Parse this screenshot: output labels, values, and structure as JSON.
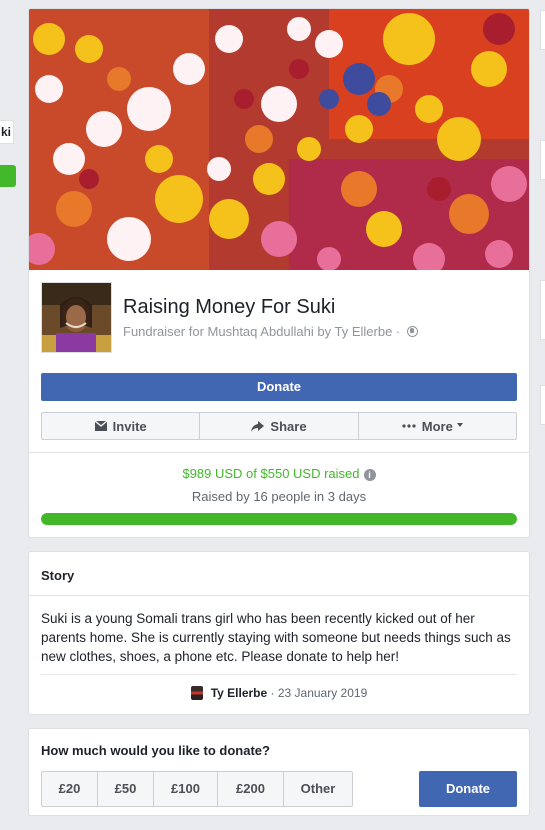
{
  "left_peek": {
    "label": "ki"
  },
  "fundraiser": {
    "title": "Raising Money For Suki",
    "subtitle": "Fundraiser for Mushtaq Abdullahi by Ty Ellerbe · ",
    "donate_label": "Donate",
    "actions": [
      {
        "label": "Invite",
        "icon": "envelope-icon"
      },
      {
        "label": "Share",
        "icon": "share-arrow-icon"
      },
      {
        "label": "More",
        "icon": "ellipsis-icon"
      }
    ],
    "raised_text": "$989 USD of $550 USD raised",
    "raised_by_text": "Raised by 16 people in 3 days",
    "progress_fraction": 1.0
  },
  "story": {
    "heading": "Story",
    "body": "Suki is a young Somali trans girl who has been recently kicked out of her parents home. She is currently staying with someone but needs things such as new clothes, shoes, a phone etc. Please donate to help her!",
    "author": "Ty Ellerbe",
    "date": " · 23 January 2019"
  },
  "donate_box": {
    "question": "How much would you like to donate?",
    "amounts": [
      "£20",
      "£50",
      "£100",
      "£200",
      "Other"
    ],
    "donate_label": "Donate"
  },
  "colors": {
    "accent_blue": "#4267b2",
    "progress_green": "#42b72a",
    "background": "#e9ebee"
  }
}
